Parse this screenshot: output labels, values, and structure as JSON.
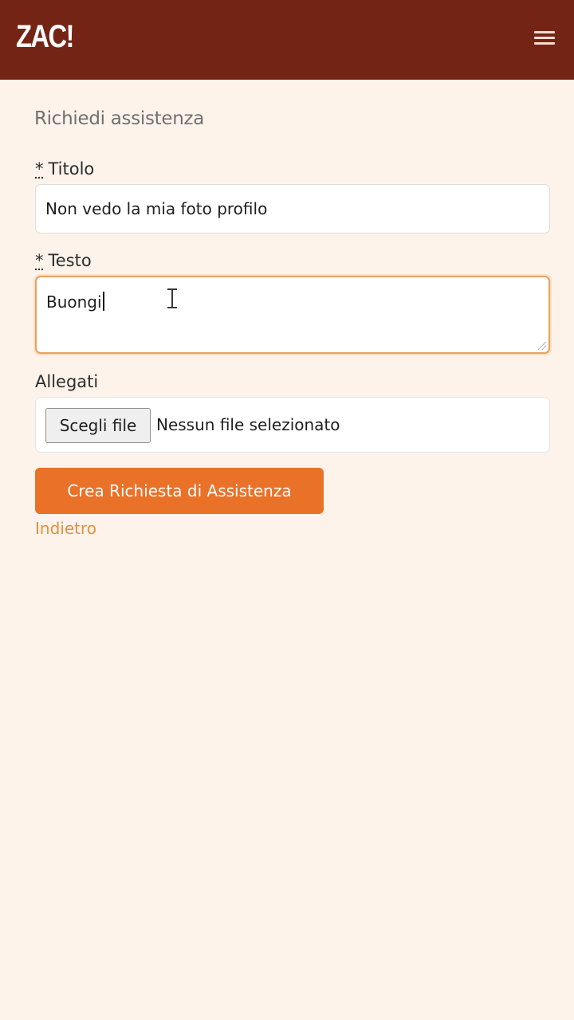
{
  "header": {
    "logo_text": "ZAC!",
    "menu_icon": "hamburger-menu-icon",
    "background_color": "#742415"
  },
  "form": {
    "page_title": "Richiedi assistenza",
    "required_marker": "*",
    "title_label": "Titolo",
    "title_value": "Non vedo la mia foto profilo",
    "text_label": "Testo",
    "text_value": "Buongi",
    "attachments_label": "Allegati",
    "file_button_label": "Scegli file",
    "file_status": "Nessun file selezionato",
    "submit_label": "Crea Richiesta di Assistenza",
    "back_label": "Indietro"
  },
  "colors": {
    "page_background": "#fdf3ea",
    "accent": "#ea7128",
    "link": "#e3903f"
  }
}
